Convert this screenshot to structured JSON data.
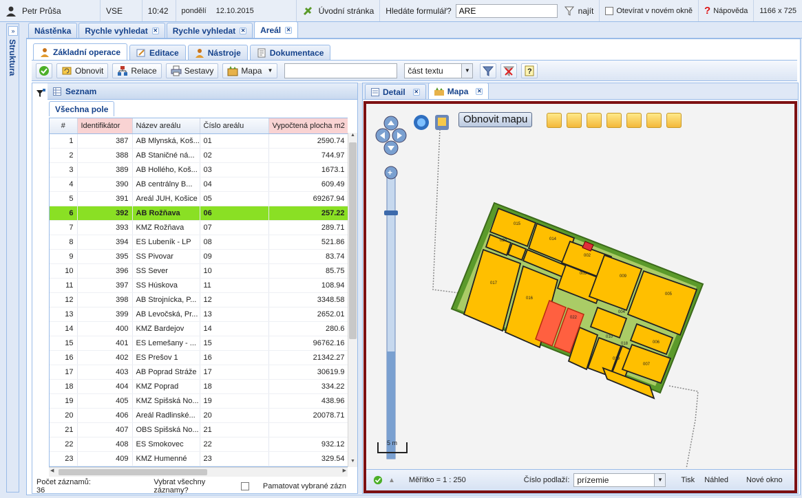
{
  "topbar": {
    "user": "Petr Průša",
    "org": "VSE",
    "time": "10:42",
    "day": "pondělí",
    "date": "12.10.2015",
    "home_link": "Úvodní stránka",
    "search_label": "Hledáte formulář?",
    "search_value": "ARE",
    "find_label": "najít",
    "new_window_label": "Otevírat v novém okně",
    "help_label": "Nápověda",
    "resolution": "1166 x 725"
  },
  "sidebar": {
    "label": "Struktura",
    "toggle": "»"
  },
  "main_tabs": [
    {
      "label": "Nástěnka",
      "closable": false
    },
    {
      "label": "Rychle vyhledat",
      "closable": true
    },
    {
      "label": "Rychle vyhledat",
      "closable": true
    },
    {
      "label": "Areál",
      "closable": true,
      "active": true
    }
  ],
  "op_tabs": [
    {
      "label": "Základní operace",
      "active": true
    },
    {
      "label": "Editace"
    },
    {
      "label": "Nástroje"
    },
    {
      "label": "Dokumentace"
    }
  ],
  "toolbar": {
    "refresh": "Obnovit",
    "relations": "Relace",
    "reports": "Sestavy",
    "map": "Mapa",
    "search_value": "",
    "match_mode": "část textu"
  },
  "list": {
    "title": "Seznam",
    "subtab": "Všechna pole",
    "columns": [
      "#",
      "Identifikátor",
      "Název areálu",
      "Číslo areálu",
      "Vypočtená plocha m2"
    ],
    "rows": [
      [
        "1",
        "387",
        "AB Mlynská, Koš...",
        "01",
        "2590.74"
      ],
      [
        "2",
        "388",
        "AB Staničné ná...",
        "02",
        "744.97"
      ],
      [
        "3",
        "389",
        "AB Hollého, Koš...",
        "03",
        "1673.1"
      ],
      [
        "4",
        "390",
        "AB centrálny B...",
        "04",
        "609.49"
      ],
      [
        "5",
        "391",
        "Areál JUH, Košice",
        "05",
        "69267.94"
      ],
      [
        "6",
        "392",
        "AB Rožňava",
        "06",
        "257.22"
      ],
      [
        "7",
        "393",
        "KMZ Rožňava",
        "07",
        "289.71"
      ],
      [
        "8",
        "394",
        "ES Lubeník - LP",
        "08",
        "521.86"
      ],
      [
        "9",
        "395",
        "SS Pivovar",
        "09",
        "83.74"
      ],
      [
        "10",
        "396",
        "SS Sever",
        "10",
        "85.75"
      ],
      [
        "11",
        "397",
        "SS Húskova",
        "11",
        "108.94"
      ],
      [
        "12",
        "398",
        "AB Strojnícka, P...",
        "12",
        "3348.58"
      ],
      [
        "13",
        "399",
        "AB Levočská, Pr...",
        "13",
        "2652.01"
      ],
      [
        "14",
        "400",
        "KMZ Bardejov",
        "14",
        "280.6"
      ],
      [
        "15",
        "401",
        "ES Lemešany - ...",
        "15",
        "96762.16"
      ],
      [
        "16",
        "402",
        "ES Prešov 1",
        "16",
        "21342.27"
      ],
      [
        "17",
        "403",
        "AB Poprad Stráže",
        "17",
        "30619.9"
      ],
      [
        "18",
        "404",
        "KMZ Poprad",
        "18",
        "334.22"
      ],
      [
        "19",
        "405",
        "KMZ Spišská No...",
        "19",
        "438.96"
      ],
      [
        "20",
        "406",
        "Areál Radlinské...",
        "20",
        "20078.71"
      ],
      [
        "21",
        "407",
        "OBS Spišská No...",
        "21",
        ""
      ],
      [
        "22",
        "408",
        "ES Smokovec",
        "22",
        "932.12"
      ],
      [
        "23",
        "409",
        "KMZ Humenné",
        "23",
        "329.54"
      ]
    ],
    "selected_row": 6,
    "count_label": "Počet záznamů: 36",
    "select_all_label": "Vybrat všechny záznamy?",
    "remember_label": "Pamatovat vybrané zázn"
  },
  "right_tabs": [
    {
      "label": "Detail"
    },
    {
      "label": "Mapa",
      "active": true
    }
  ],
  "map": {
    "refresh_label": "Obnovit mapu",
    "scale_label": "5 m",
    "scale_text": "Měřítko = 1 : 250",
    "floor_label": "Číslo podlaží:",
    "floor_value": "prízemie",
    "print": "Tisk",
    "preview": "Náhled",
    "new_window": "Nové okno",
    "rooms": [
      "015",
      "014",
      "020",
      "002",
      "003",
      "009",
      "005",
      "017",
      "016",
      "022",
      "004",
      "010",
      "018",
      "006",
      "007",
      "019"
    ]
  }
}
